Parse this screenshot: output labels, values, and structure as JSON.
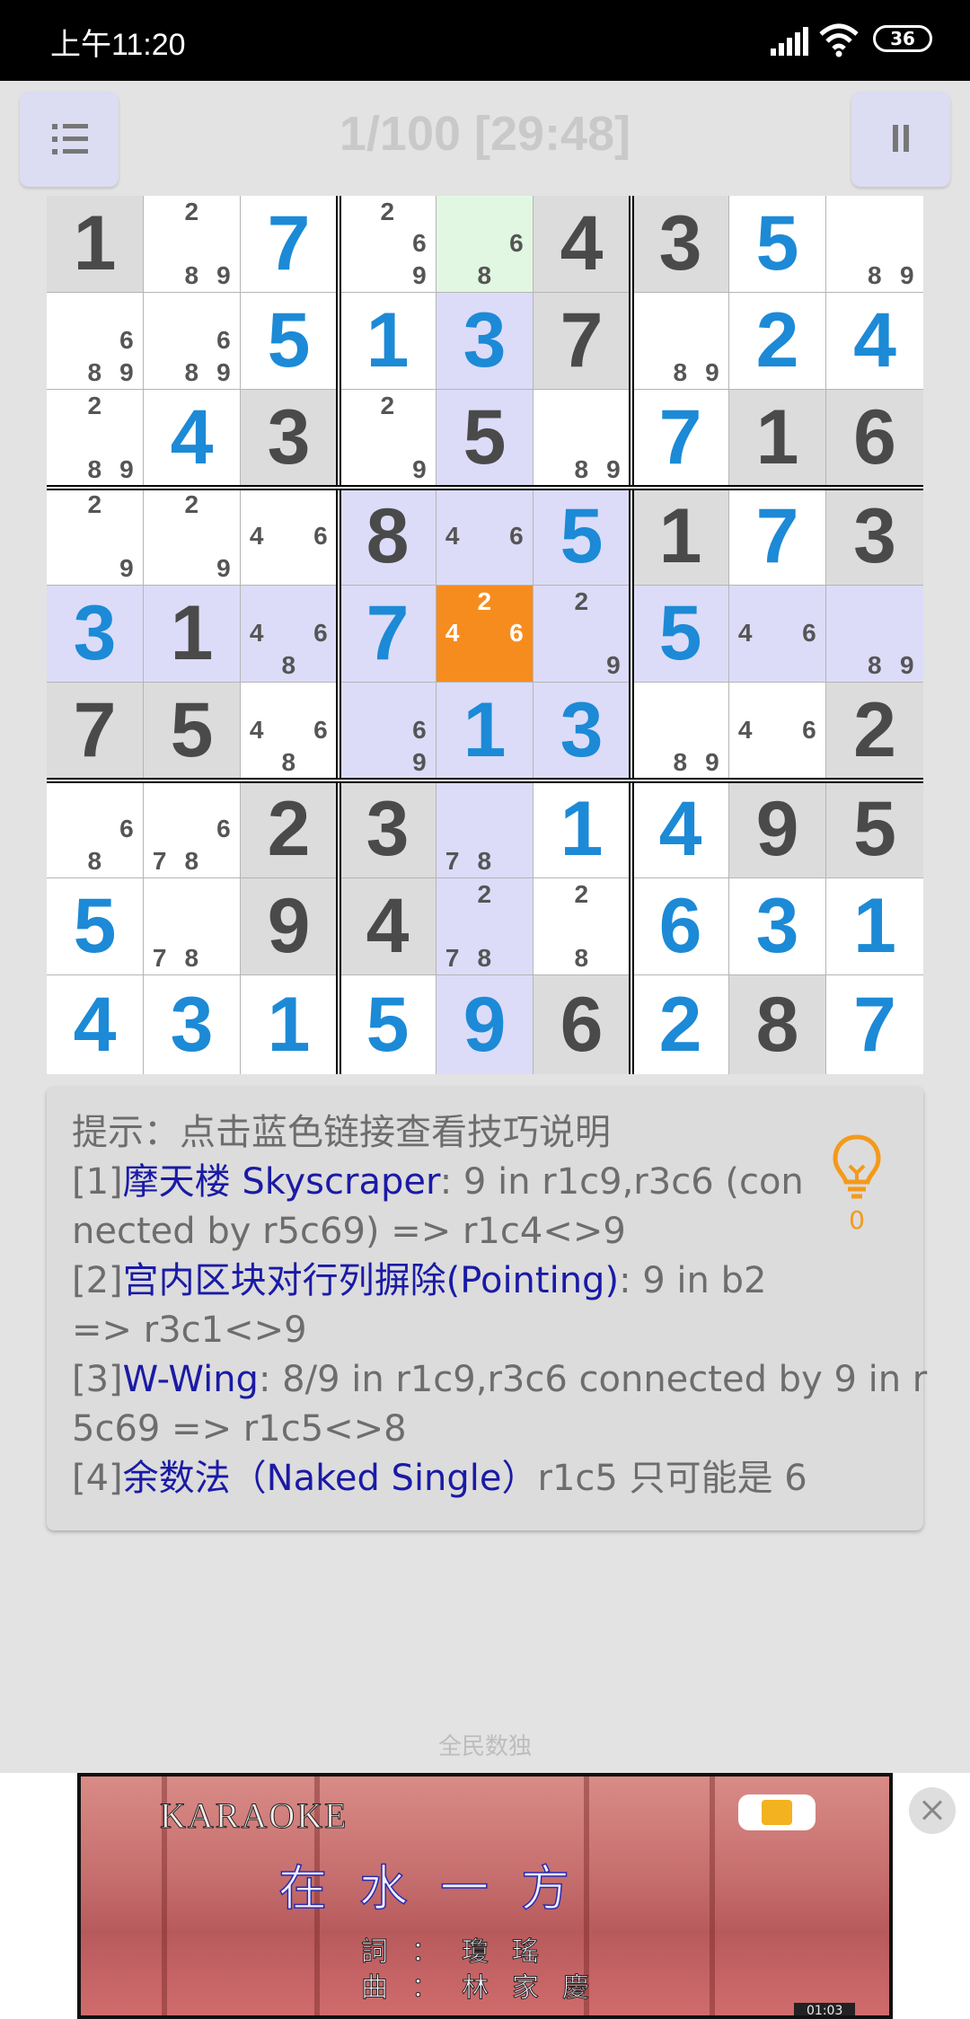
{
  "status": {
    "time": "上午11:20",
    "battery": "36"
  },
  "header": {
    "title": "1/100 [29:48]"
  },
  "board": {
    "rows": [
      [
        {
          "v": "1",
          "t": "given",
          "bg": "gray"
        },
        {
          "c": "289",
          "bg": "white"
        },
        {
          "v": "7",
          "t": "user",
          "bg": "white"
        },
        {
          "c": "269",
          "bg": "white"
        },
        {
          "c": "68",
          "bg": "green"
        },
        {
          "v": "4",
          "t": "given",
          "bg": "gray"
        },
        {
          "v": "3",
          "t": "given",
          "bg": "gray"
        },
        {
          "v": "5",
          "t": "user",
          "bg": "white"
        },
        {
          "c": "89",
          "bg": "white"
        }
      ],
      [
        {
          "c": "689",
          "bg": "white"
        },
        {
          "c": "689",
          "bg": "white"
        },
        {
          "v": "5",
          "t": "user",
          "bg": "white"
        },
        {
          "v": "1",
          "t": "user",
          "bg": "white"
        },
        {
          "v": "3",
          "t": "user",
          "bg": "lav"
        },
        {
          "v": "7",
          "t": "given",
          "bg": "gray"
        },
        {
          "c": "89",
          "bg": "white"
        },
        {
          "v": "2",
          "t": "user",
          "bg": "white"
        },
        {
          "v": "4",
          "t": "user",
          "bg": "white"
        }
      ],
      [
        {
          "c": "289",
          "bg": "white"
        },
        {
          "v": "4",
          "t": "user",
          "bg": "white"
        },
        {
          "v": "3",
          "t": "given",
          "bg": "gray"
        },
        {
          "c": "29",
          "bg": "white"
        },
        {
          "v": "5",
          "t": "given",
          "bg": "lav"
        },
        {
          "c": "89",
          "bg": "white"
        },
        {
          "v": "7",
          "t": "user",
          "bg": "white"
        },
        {
          "v": "1",
          "t": "given",
          "bg": "gray"
        },
        {
          "v": "6",
          "t": "given",
          "bg": "gray"
        }
      ],
      [
        {
          "c": "29",
          "bg": "white"
        },
        {
          "c": "29",
          "bg": "white"
        },
        {
          "c": "46",
          "bg": "white"
        },
        {
          "v": "8",
          "t": "given",
          "bg": "lav"
        },
        {
          "c": "46",
          "bg": "lav"
        },
        {
          "v": "5",
          "t": "user",
          "bg": "lav"
        },
        {
          "v": "1",
          "t": "given",
          "bg": "gray"
        },
        {
          "v": "7",
          "t": "user",
          "bg": "white"
        },
        {
          "v": "3",
          "t": "given",
          "bg": "gray"
        }
      ],
      [
        {
          "v": "3",
          "t": "user",
          "bg": "lav"
        },
        {
          "v": "1",
          "t": "given",
          "bg": "lav"
        },
        {
          "c": "468",
          "bg": "lav"
        },
        {
          "v": "7",
          "t": "user",
          "bg": "lav"
        },
        {
          "c": "246",
          "bg": "orange"
        },
        {
          "c": "29",
          "bg": "lav"
        },
        {
          "v": "5",
          "t": "user",
          "bg": "lav"
        },
        {
          "c": "46",
          "bg": "lav"
        },
        {
          "c": "89",
          "bg": "lav"
        }
      ],
      [
        {
          "v": "7",
          "t": "given",
          "bg": "gray"
        },
        {
          "v": "5",
          "t": "given",
          "bg": "gray"
        },
        {
          "c": "468",
          "bg": "white"
        },
        {
          "c": "69",
          "bg": "lav"
        },
        {
          "v": "1",
          "t": "user",
          "bg": "lav"
        },
        {
          "v": "3",
          "t": "user",
          "bg": "lav"
        },
        {
          "c": "89",
          "bg": "white"
        },
        {
          "c": "46",
          "bg": "white"
        },
        {
          "v": "2",
          "t": "given",
          "bg": "gray"
        }
      ],
      [
        {
          "c": "68",
          "bg": "white"
        },
        {
          "c": "678",
          "bg": "white"
        },
        {
          "v": "2",
          "t": "given",
          "bg": "gray"
        },
        {
          "v": "3",
          "t": "given",
          "bg": "gray"
        },
        {
          "c": "78",
          "bg": "lav"
        },
        {
          "v": "1",
          "t": "user",
          "bg": "white"
        },
        {
          "v": "4",
          "t": "user",
          "bg": "white"
        },
        {
          "v": "9",
          "t": "given",
          "bg": "gray"
        },
        {
          "v": "5",
          "t": "given",
          "bg": "gray"
        }
      ],
      [
        {
          "v": "5",
          "t": "user",
          "bg": "white"
        },
        {
          "c": "78",
          "bg": "white"
        },
        {
          "v": "9",
          "t": "given",
          "bg": "gray"
        },
        {
          "v": "4",
          "t": "given",
          "bg": "gray"
        },
        {
          "c": "278",
          "bg": "lav"
        },
        {
          "c": "28",
          "bg": "white"
        },
        {
          "v": "6",
          "t": "user",
          "bg": "white"
        },
        {
          "v": "3",
          "t": "user",
          "bg": "white"
        },
        {
          "v": "1",
          "t": "user",
          "bg": "white"
        }
      ],
      [
        {
          "v": "4",
          "t": "user",
          "bg": "white"
        },
        {
          "v": "3",
          "t": "user",
          "bg": "white"
        },
        {
          "v": "1",
          "t": "user",
          "bg": "white"
        },
        {
          "v": "5",
          "t": "user",
          "bg": "white"
        },
        {
          "v": "9",
          "t": "user",
          "bg": "lav"
        },
        {
          "v": "6",
          "t": "given",
          "bg": "gray"
        },
        {
          "v": "2",
          "t": "user",
          "bg": "white"
        },
        {
          "v": "8",
          "t": "given",
          "bg": "gray"
        },
        {
          "v": "7",
          "t": "user",
          "bg": "white"
        }
      ]
    ]
  },
  "hint": {
    "intro": "提示：点击蓝色链接查看技巧说明",
    "h1_num": "[1]",
    "h1_link": "摩天楼 Skyscraper",
    "h1_text_a": ": 9 in r1c9,r3c6 (con",
    "h1_text_b": "nected by r5c69) => r1c4<>9",
    "h2_num": "[2]",
    "h2_link": "宫内区块对行列摒除(Pointing)",
    "h2_text_a": ": 9 in b2",
    "h2_text_b": "=> r3c1<>9",
    "h3_num": "[3]",
    "h3_link": "W-Wing",
    "h3_text_a": ": 8/9 in r1c9,r3c6 connected by 9 in r",
    "h3_text_b": "5c69 => r1c5<>8",
    "h4_num": "[4]",
    "h4_link": "余数法（Naked Single）",
    "h4_text": "r1c5 只可能是 6",
    "bulb_count": "0"
  },
  "footer": {
    "label": "全民数独"
  },
  "ad": {
    "karaoke": "KARAOKE",
    "song": "在水一方",
    "credit1": "詞：瓊瑤",
    "credit2": "曲：林家慶",
    "timestamp": "01:03"
  },
  "colors": {
    "given": "#4a4a4a",
    "user": "#1c8ad6",
    "selected": "#f78c1e",
    "link": "#1a1aa6"
  }
}
